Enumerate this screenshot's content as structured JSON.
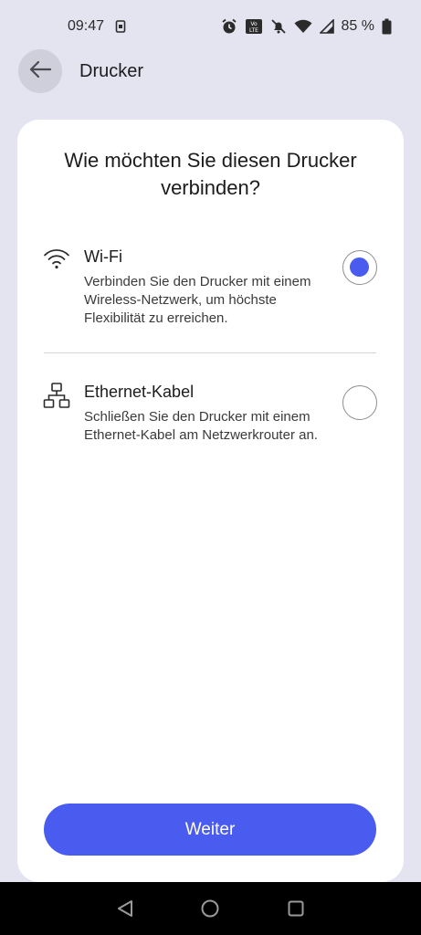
{
  "status": {
    "time": "09:47",
    "battery": "85 %",
    "icons": [
      "screenshot-icon",
      "alarm-icon",
      "volte-icon",
      "mute-icon",
      "wifi-icon",
      "signal-icon",
      "battery-icon"
    ]
  },
  "app_bar": {
    "title": "Drucker",
    "back_icon": "arrow-left-icon"
  },
  "card": {
    "title": "Wie möchten Sie diesen Drucker verbinden?",
    "options": [
      {
        "icon": "wifi-icon",
        "title": "Wi-Fi",
        "description": "Verbinden Sie den Drucker mit einem Wireless-Netzwerk, um höchste Flexibilität zu erreichen.",
        "selected": true
      },
      {
        "icon": "network-icon",
        "title": "Ethernet-Kabel",
        "description": "Schließen Sie den Drucker mit einem Ethernet-Kabel am Netzwerkrouter an.",
        "selected": false
      }
    ],
    "button_label": "Weiter"
  },
  "colors": {
    "accent": "#4a5cf0",
    "background": "#e4e4f0",
    "card": "#ffffff"
  },
  "nav": {
    "icons": [
      "back-triangle-icon",
      "home-circle-icon",
      "recents-square-icon"
    ]
  }
}
